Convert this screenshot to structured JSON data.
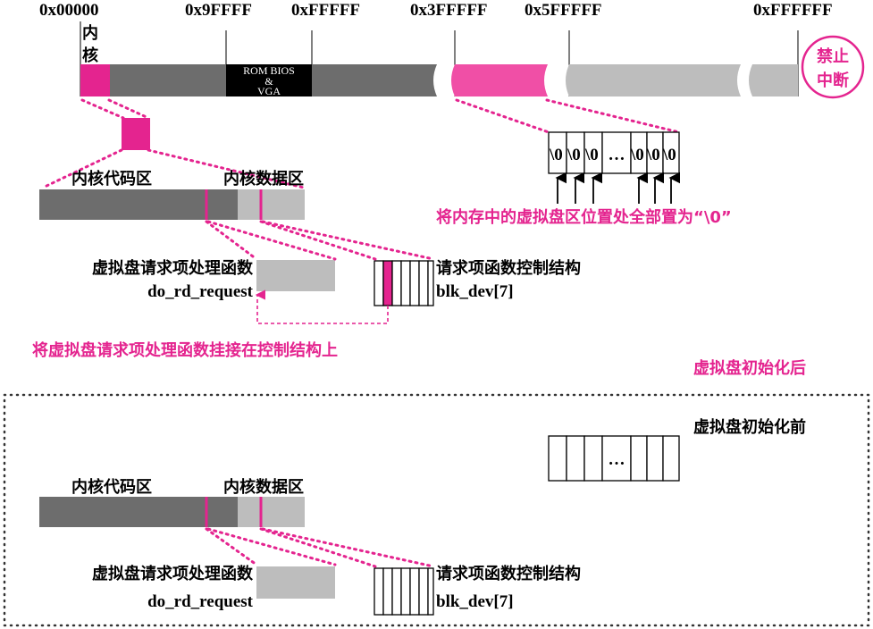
{
  "addresses": [
    "0x00000",
    "0x9FFFF",
    "0xFFFFF",
    "0x3FFFFF",
    "0x5FFFFF",
    "0xFFFFFF"
  ],
  "kernel_short_1": "内",
  "kernel_short_2": "核",
  "rom_bios_1": "ROM BIOS",
  "rom_bios_2": "&",
  "rom_bios_3": "VGA",
  "badge_line1": "禁止",
  "badge_line2": "中断",
  "kernel_code": "内核代码区",
  "kernel_data": "内核数据区",
  "ramdisk_cell": "\\0",
  "ellipsis": "…",
  "zero_note": "将内存中的虚拟盘区位置处全部置为“\\0”",
  "handler_name": "虚拟盘请求项处理函数",
  "handler_func": "do_rd_request",
  "ctrl_name": "请求项函数控制结构",
  "ctrl_var": "blk_dev[7]",
  "hook_note": "将虚拟盘请求项处理函数挂接在控制结构上",
  "after_label": "虚拟盘初始化后",
  "before_label": "虚拟盘初始化前",
  "colors": {
    "pink": "#e4248f",
    "dark_gray": "#6d6d6d",
    "light_gray": "#bdbdbd",
    "black": "#000000"
  }
}
